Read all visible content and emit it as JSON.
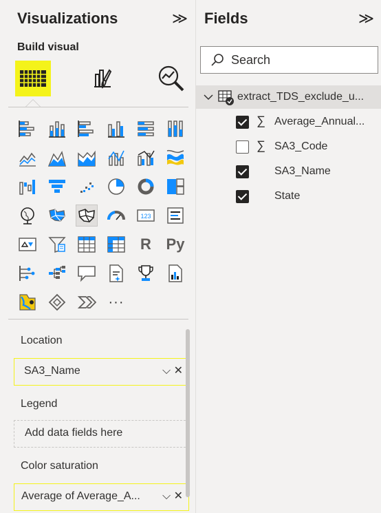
{
  "visualizations": {
    "title": "Visualizations",
    "collapse_glyph": "≫",
    "build_visual_label": "Build visual",
    "tabs": [
      {
        "name": "build-visual-tab",
        "icon": "build-visual-grid-icon",
        "active": true
      },
      {
        "name": "format-visual-tab",
        "icon": "format-paintbrush-icon",
        "active": false
      },
      {
        "name": "analytics-tab",
        "icon": "analytics-magnifier-icon",
        "active": false
      }
    ],
    "more_glyph": "···",
    "r_label": "R",
    "py_label": "Py",
    "wells": {
      "location": {
        "label": "Location",
        "value": "SA3_Name"
      },
      "legend": {
        "label": "Legend",
        "placeholder": "Add data fields here"
      },
      "color_saturation": {
        "label": "Color saturation",
        "value": "Average of Average_A..."
      }
    },
    "well_actions": "⌵ ✕",
    "highlight_color": "#f4f31a"
  },
  "fields": {
    "title": "Fields",
    "collapse_glyph": "≫",
    "search_placeholder": "Search",
    "table": {
      "name": "extract_TDS_exclude_u...",
      "expanded": true,
      "items": [
        {
          "label": "Average_Annual...",
          "checked": true,
          "sigma": true
        },
        {
          "label": "SA3_Code",
          "checked": false,
          "sigma": true
        },
        {
          "label": "SA3_Name",
          "checked": true,
          "sigma": false
        },
        {
          "label": "State",
          "checked": true,
          "sigma": false
        }
      ]
    },
    "sigma_glyph": "∑"
  }
}
